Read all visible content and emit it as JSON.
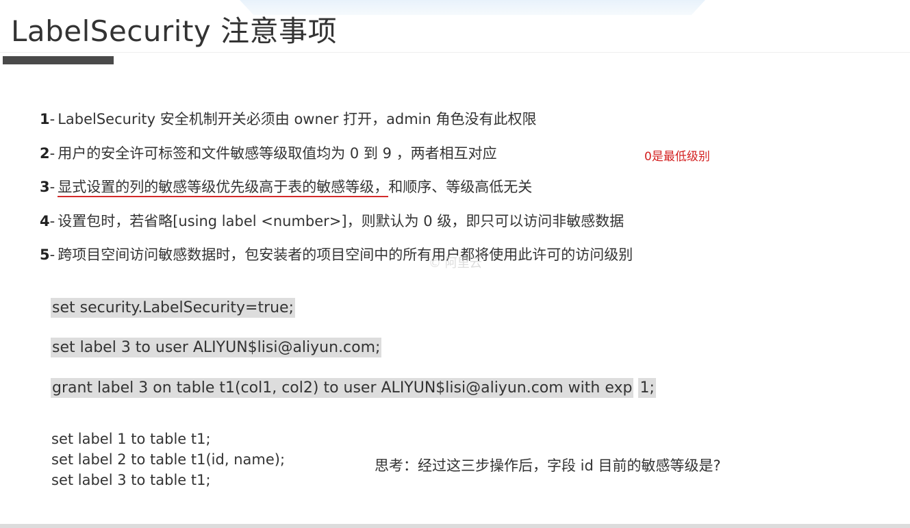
{
  "title": "LabelSecurity 注意事项",
  "notes": [
    {
      "num": "1",
      "text": "LabelSecurity 安全机制开关必须由 owner 打开，admin 角色没有此权限"
    },
    {
      "num": "2",
      "text": "用户的安全许可标签和文件敏感等级取值均为 0 到 9 ，两者相互对应"
    },
    {
      "num": "3",
      "underlined": "显式设置的列的敏感等级优先级高于表的敏感等级，",
      "text": "和顺序、等级高低无关"
    },
    {
      "num": "4",
      "text": "设置包时，若省略[using label <number>]，则默认为 0 级，即只可以访问非敏感数据"
    },
    {
      "num": "5",
      "text": "跨项目空间访问敏感数据时，包安装者的项目空间中的所有用户都将使用此许可的访问级别"
    }
  ],
  "annotation": "0是最低级别",
  "watermark": "© 阿里云",
  "code_highlighted": [
    {
      "text": "set security.LabelSecurity=true;"
    },
    {
      "text": "set label 3 to user ALIYUN$lisi@aliyun.com;"
    },
    {
      "text": "grant label 3 on table t1(col1, col2) to user ALIYUN$lisi@aliyun.com  with exp",
      "suffix": "1;"
    }
  ],
  "code_plain": [
    "set label 1 to table t1;",
    "set label 2 to table t1(id, name);",
    "set label 3 to table t1;"
  ],
  "thinking": "思考：经过这三步操作后，字段 id 目前的敏感等级是?"
}
